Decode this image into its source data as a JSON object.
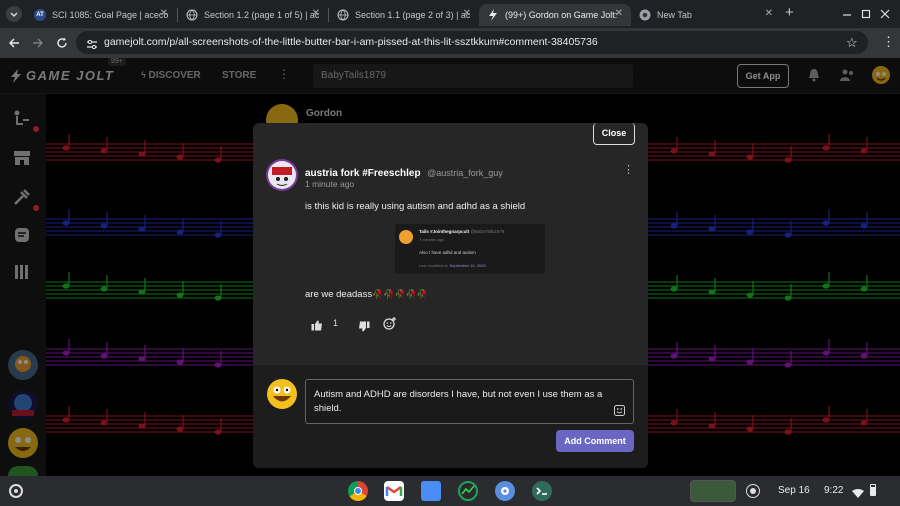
{
  "browser": {
    "tabs": [
      {
        "title": "SCI 1085: Goal Page | aceco",
        "favicon": "AT"
      },
      {
        "title": "Section 1.2 (page 1 of 5) | ac",
        "favicon": "globe-icon"
      },
      {
        "title": "Section 1.1 (page 2 of 3) | ac",
        "favicon": "globe-icon"
      },
      {
        "title": "(99+) Gordon on Game Jolt:",
        "favicon": "gamejolt-icon"
      },
      {
        "title": "New Tab",
        "favicon": "chrome-icon"
      }
    ],
    "new_tab": "+",
    "url": "gamejolt.com/p/all-screenshots-of-the-little-butter-bar-i-am-pissed-at-this-lit-ssztkkum#comment-38405736"
  },
  "site": {
    "logo": "GAME JOLT",
    "notification_badge": "99+",
    "nav_discover": "DISCOVER",
    "nav_store": "STORE",
    "search_value": "BabyTails1879",
    "get_app": "Get App",
    "post_author": "Gordon"
  },
  "modal": {
    "close": "Close",
    "comment": {
      "author": "austria fork #Freeschlep",
      "handle": "@austria_fork_guy",
      "time": "1 minute ago",
      "text1": "is this kid is really using autism and adhd as a shield",
      "embed": {
        "name": "Tails #Jointhegnarpcult",
        "handle": "@BabyTails1879",
        "time": "7 minutes ago",
        "body": "Also I have adhd and autism",
        "modified_label": "Last modified on",
        "modified_date": "September 16, 2025"
      },
      "text2": "are we deadass",
      "text2_emoji": "🥀🥀🥀🥀🥀",
      "likes": "1"
    },
    "reply": {
      "value": "Autism and ADHD are disorders I have, but not even I use them as a shield.",
      "submit": "Add Comment"
    }
  },
  "shelf": {
    "date": "Sep 16",
    "time": "9:22"
  },
  "colors": {
    "accent": "#6b66c3",
    "gamejolt_green": "#ccff00",
    "modal_bg": "#262626"
  }
}
